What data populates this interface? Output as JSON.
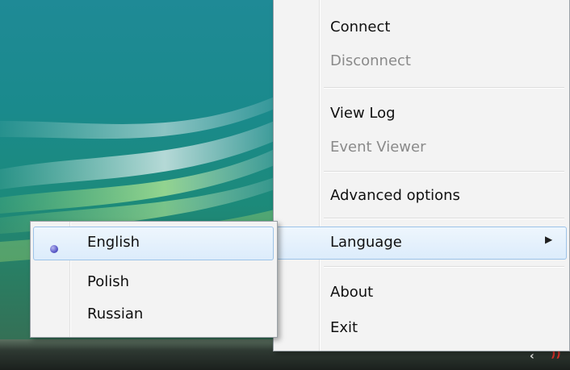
{
  "main_menu": {
    "items": [
      {
        "label": "Connect",
        "enabled": true
      },
      {
        "label": "Disconnect",
        "enabled": false
      },
      {
        "label": "View Log",
        "enabled": true
      },
      {
        "label": "Event Viewer",
        "enabled": false
      },
      {
        "label": "Advanced options",
        "enabled": true
      },
      {
        "label": "Language",
        "enabled": true,
        "has_submenu": true,
        "highlighted": true
      },
      {
        "label": "About",
        "enabled": true
      },
      {
        "label": "Exit",
        "enabled": true
      }
    ],
    "submenu_arrow": "▶"
  },
  "language_menu": {
    "items": [
      {
        "label": "English",
        "selected": true
      },
      {
        "label": "Polish",
        "selected": false
      },
      {
        "label": "Russian",
        "selected": false
      }
    ]
  },
  "tray": {
    "icons": [
      "chevron-left-icon",
      "network-activity-icon"
    ],
    "chevron": "‹",
    "network": "))"
  },
  "colors": {
    "highlight_border": "#9cc3e8",
    "disabled_text": "#8a8a8a",
    "radio_dot": "#5a5ac8"
  }
}
